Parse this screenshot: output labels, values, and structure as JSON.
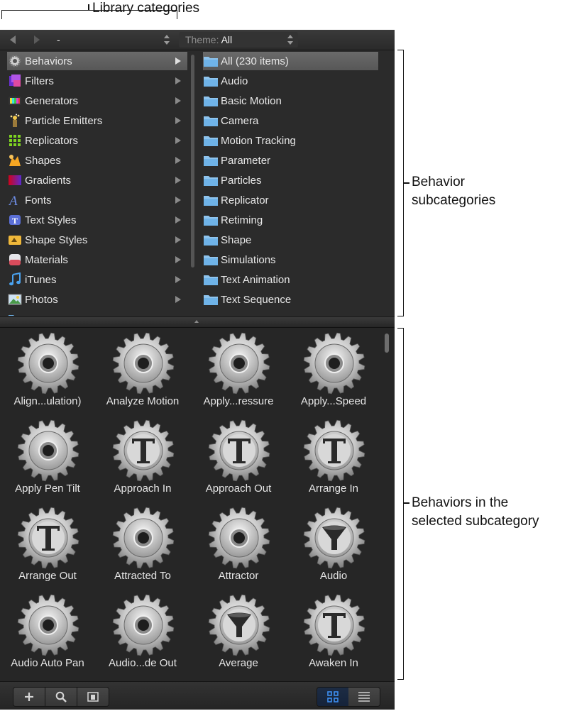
{
  "annotations": {
    "top": "Library categories",
    "right_1": [
      "Behavior",
      "subcategories"
    ],
    "right_2": [
      "Behaviors in the",
      "selected subcategory"
    ]
  },
  "topbar": {
    "path_value": "-",
    "theme_label": "Theme:",
    "theme_value": "All"
  },
  "categories": [
    {
      "label": "Behaviors",
      "icon": "gear-icon",
      "selected": true
    },
    {
      "label": "Filters",
      "icon": "filters-icon"
    },
    {
      "label": "Generators",
      "icon": "generators-icon"
    },
    {
      "label": "Particle Emitters",
      "icon": "particle-emitters-icon"
    },
    {
      "label": "Replicators",
      "icon": "replicators-icon"
    },
    {
      "label": "Shapes",
      "icon": "shapes-icon"
    },
    {
      "label": "Gradients",
      "icon": "gradients-icon"
    },
    {
      "label": "Fonts",
      "icon": "fonts-icon"
    },
    {
      "label": "Text Styles",
      "icon": "text-styles-icon"
    },
    {
      "label": "Shape Styles",
      "icon": "shape-styles-icon"
    },
    {
      "label": "Materials",
      "icon": "materials-icon"
    },
    {
      "label": "iTunes",
      "icon": "music-note-icon"
    },
    {
      "label": "Photos",
      "icon": "photos-icon"
    }
  ],
  "subcategories": [
    {
      "label": "All (230 items)",
      "selected": true
    },
    {
      "label": "Audio"
    },
    {
      "label": "Basic Motion"
    },
    {
      "label": "Camera"
    },
    {
      "label": "Motion Tracking"
    },
    {
      "label": "Parameter"
    },
    {
      "label": "Particles"
    },
    {
      "label": "Replicator"
    },
    {
      "label": "Retiming"
    },
    {
      "label": "Shape"
    },
    {
      "label": "Simulations"
    },
    {
      "label": "Text Animation"
    },
    {
      "label": "Text Sequence"
    }
  ],
  "behaviors": [
    {
      "label": "Align...ulation)",
      "icon": "gear-icon"
    },
    {
      "label": "Analyze Motion",
      "icon": "gear-icon"
    },
    {
      "label": "Apply...ressure",
      "icon": "gear-icon"
    },
    {
      "label": "Apply...Speed",
      "icon": "gear-icon"
    },
    {
      "label": "Apply Pen Tilt",
      "icon": "gear-icon"
    },
    {
      "label": "Approach In",
      "icon": "gear-text-icon"
    },
    {
      "label": "Approach Out",
      "icon": "gear-text-icon"
    },
    {
      "label": "Arrange In",
      "icon": "gear-text-icon"
    },
    {
      "label": "Arrange Out",
      "icon": "gear-text-icon"
    },
    {
      "label": "Attracted To",
      "icon": "gear-icon"
    },
    {
      "label": "Attractor",
      "icon": "gear-icon"
    },
    {
      "label": "Audio",
      "icon": "gear-funnel-icon"
    },
    {
      "label": "Audio Auto Pan",
      "icon": "gear-icon"
    },
    {
      "label": "Audio...de Out",
      "icon": "gear-icon"
    },
    {
      "label": "Average",
      "icon": "gear-funnel-icon"
    },
    {
      "label": "Awaken In",
      "icon": "gear-text-icon"
    }
  ],
  "view_mode": "grid"
}
